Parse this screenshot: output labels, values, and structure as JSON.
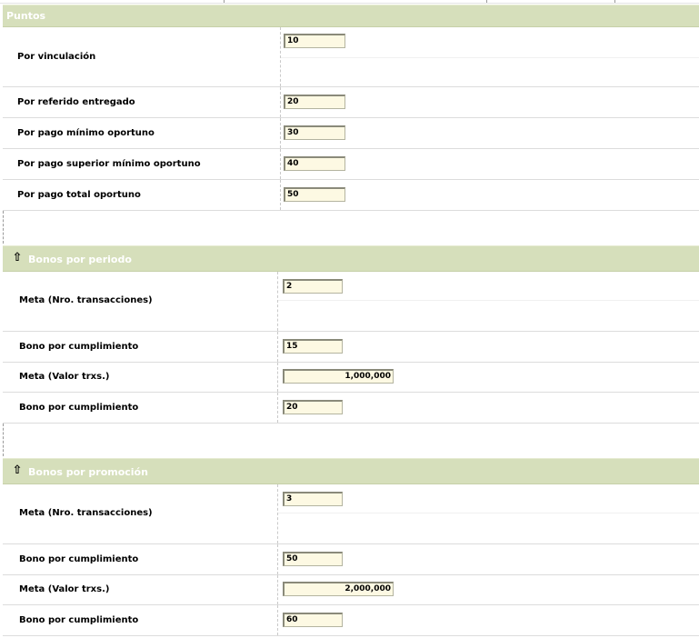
{
  "sections": {
    "puntos": {
      "title": "Puntos",
      "rows": [
        {
          "label": "Por vinculación",
          "value": "10"
        },
        {
          "label": "Por referido entregado",
          "value": "20"
        },
        {
          "label": "Por pago mínimo oportuno",
          "value": "30"
        },
        {
          "label": "Por pago superior mínimo oportuno",
          "value": "40"
        },
        {
          "label": "Por pago total oportuno",
          "value": "50"
        }
      ]
    },
    "bonos_periodo": {
      "title": "Bonos por periodo",
      "rows": [
        {
          "label": "Meta (Nro. transacciones)",
          "value": "2"
        },
        {
          "label": "Bono por cumplimiento",
          "value": "15"
        },
        {
          "label": "Meta (Valor trxs.)",
          "value": "1,000,000"
        },
        {
          "label": "Bono por cumplimiento",
          "value": "20"
        }
      ]
    },
    "bonos_promocion": {
      "title": "Bonos por promoción",
      "rows": [
        {
          "label": "Meta (Nro. transacciones)",
          "value": "3"
        },
        {
          "label": "Bono por cumplimiento",
          "value": "50"
        },
        {
          "label": "Meta (Valor trxs.)",
          "value": "2,000,000"
        },
        {
          "label": "Bono por cumplimiento",
          "value": "60"
        }
      ]
    }
  },
  "icons": {
    "collapse": "up-arrow-icon"
  },
  "colors": {
    "header_bg": "#d6dfbb",
    "header_text": "#ffffff",
    "field_bg": "#fdf9e3"
  }
}
